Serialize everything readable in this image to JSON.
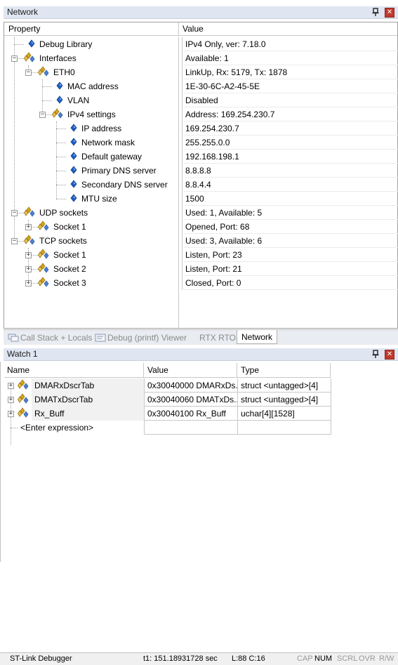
{
  "network_pane": {
    "title": "Network",
    "columns": {
      "property": "Property",
      "value": "Value"
    },
    "rows": [
      {
        "label": "Debug Library",
        "value": "IPv4 Only, ver: 7.18.0"
      },
      {
        "label": "Interfaces",
        "value": "Available: 1"
      },
      {
        "label": "ETH0",
        "value": "LinkUp, Rx: 5179, Tx: 1878"
      },
      {
        "label": "MAC address",
        "value": "1E-30-6C-A2-45-5E"
      },
      {
        "label": "VLAN",
        "value": "Disabled"
      },
      {
        "label": "IPv4 settings",
        "value": "Address: 169.254.230.7"
      },
      {
        "label": "IP address",
        "value": "169.254.230.7"
      },
      {
        "label": "Network mask",
        "value": "255.255.0.0"
      },
      {
        "label": "Default gateway",
        "value": "192.168.198.1"
      },
      {
        "label": "Primary DNS server",
        "value": "8.8.8.8"
      },
      {
        "label": "Secondary DNS server",
        "value": "8.8.4.4"
      },
      {
        "label": "MTU size",
        "value": "1500"
      },
      {
        "label": "UDP sockets",
        "value": "Used: 1, Available: 5"
      },
      {
        "label": "Socket 1",
        "value": "Opened, Port: 68"
      },
      {
        "label": "TCP sockets",
        "value": "Used: 3, Available: 6"
      },
      {
        "label": "Socket 1",
        "value": "Listen, Port: 23"
      },
      {
        "label": "Socket 2",
        "value": "Listen, Port: 21"
      },
      {
        "label": "Socket 3",
        "value": "Closed, Port: 0"
      }
    ]
  },
  "tabs": [
    {
      "label": "Call Stack + Locals",
      "icon": "call-stack-icon"
    },
    {
      "label": "Debug (printf) Viewer",
      "icon": "printf-viewer-icon"
    },
    {
      "label": "RTX RTOS"
    },
    {
      "label": "Network"
    }
  ],
  "watch_pane": {
    "title": "Watch 1",
    "columns": {
      "name": "Name",
      "value": "Value",
      "type": "Type"
    },
    "rows": [
      {
        "name": "DMARxDscrTab",
        "value": "0x30040000 DMARxDs...",
        "type": "struct <untagged>[4]"
      },
      {
        "name": "DMATxDscrTab",
        "value": "0x30040060 DMATxDs...",
        "type": "struct <untagged>[4]"
      },
      {
        "name": "Rx_Buff",
        "value": "0x30040100 Rx_Buff",
        "type": "uchar[4][1528]"
      }
    ],
    "enter_expression": "<Enter expression>"
  },
  "status_bar": {
    "debugger": "ST-Link Debugger",
    "time": "t1: 151.18931728 sec",
    "position": "L:88 C:16",
    "cap": "CAP",
    "num": "NUM",
    "scrl": "SCRL",
    "ovr": "OVR",
    "rw": "R/W"
  },
  "colors": {
    "title_bar": "#dfe6f2",
    "property_icon": "#1f5fbf",
    "folder_icon": "#d9a520",
    "close_button": "#c0392b"
  }
}
